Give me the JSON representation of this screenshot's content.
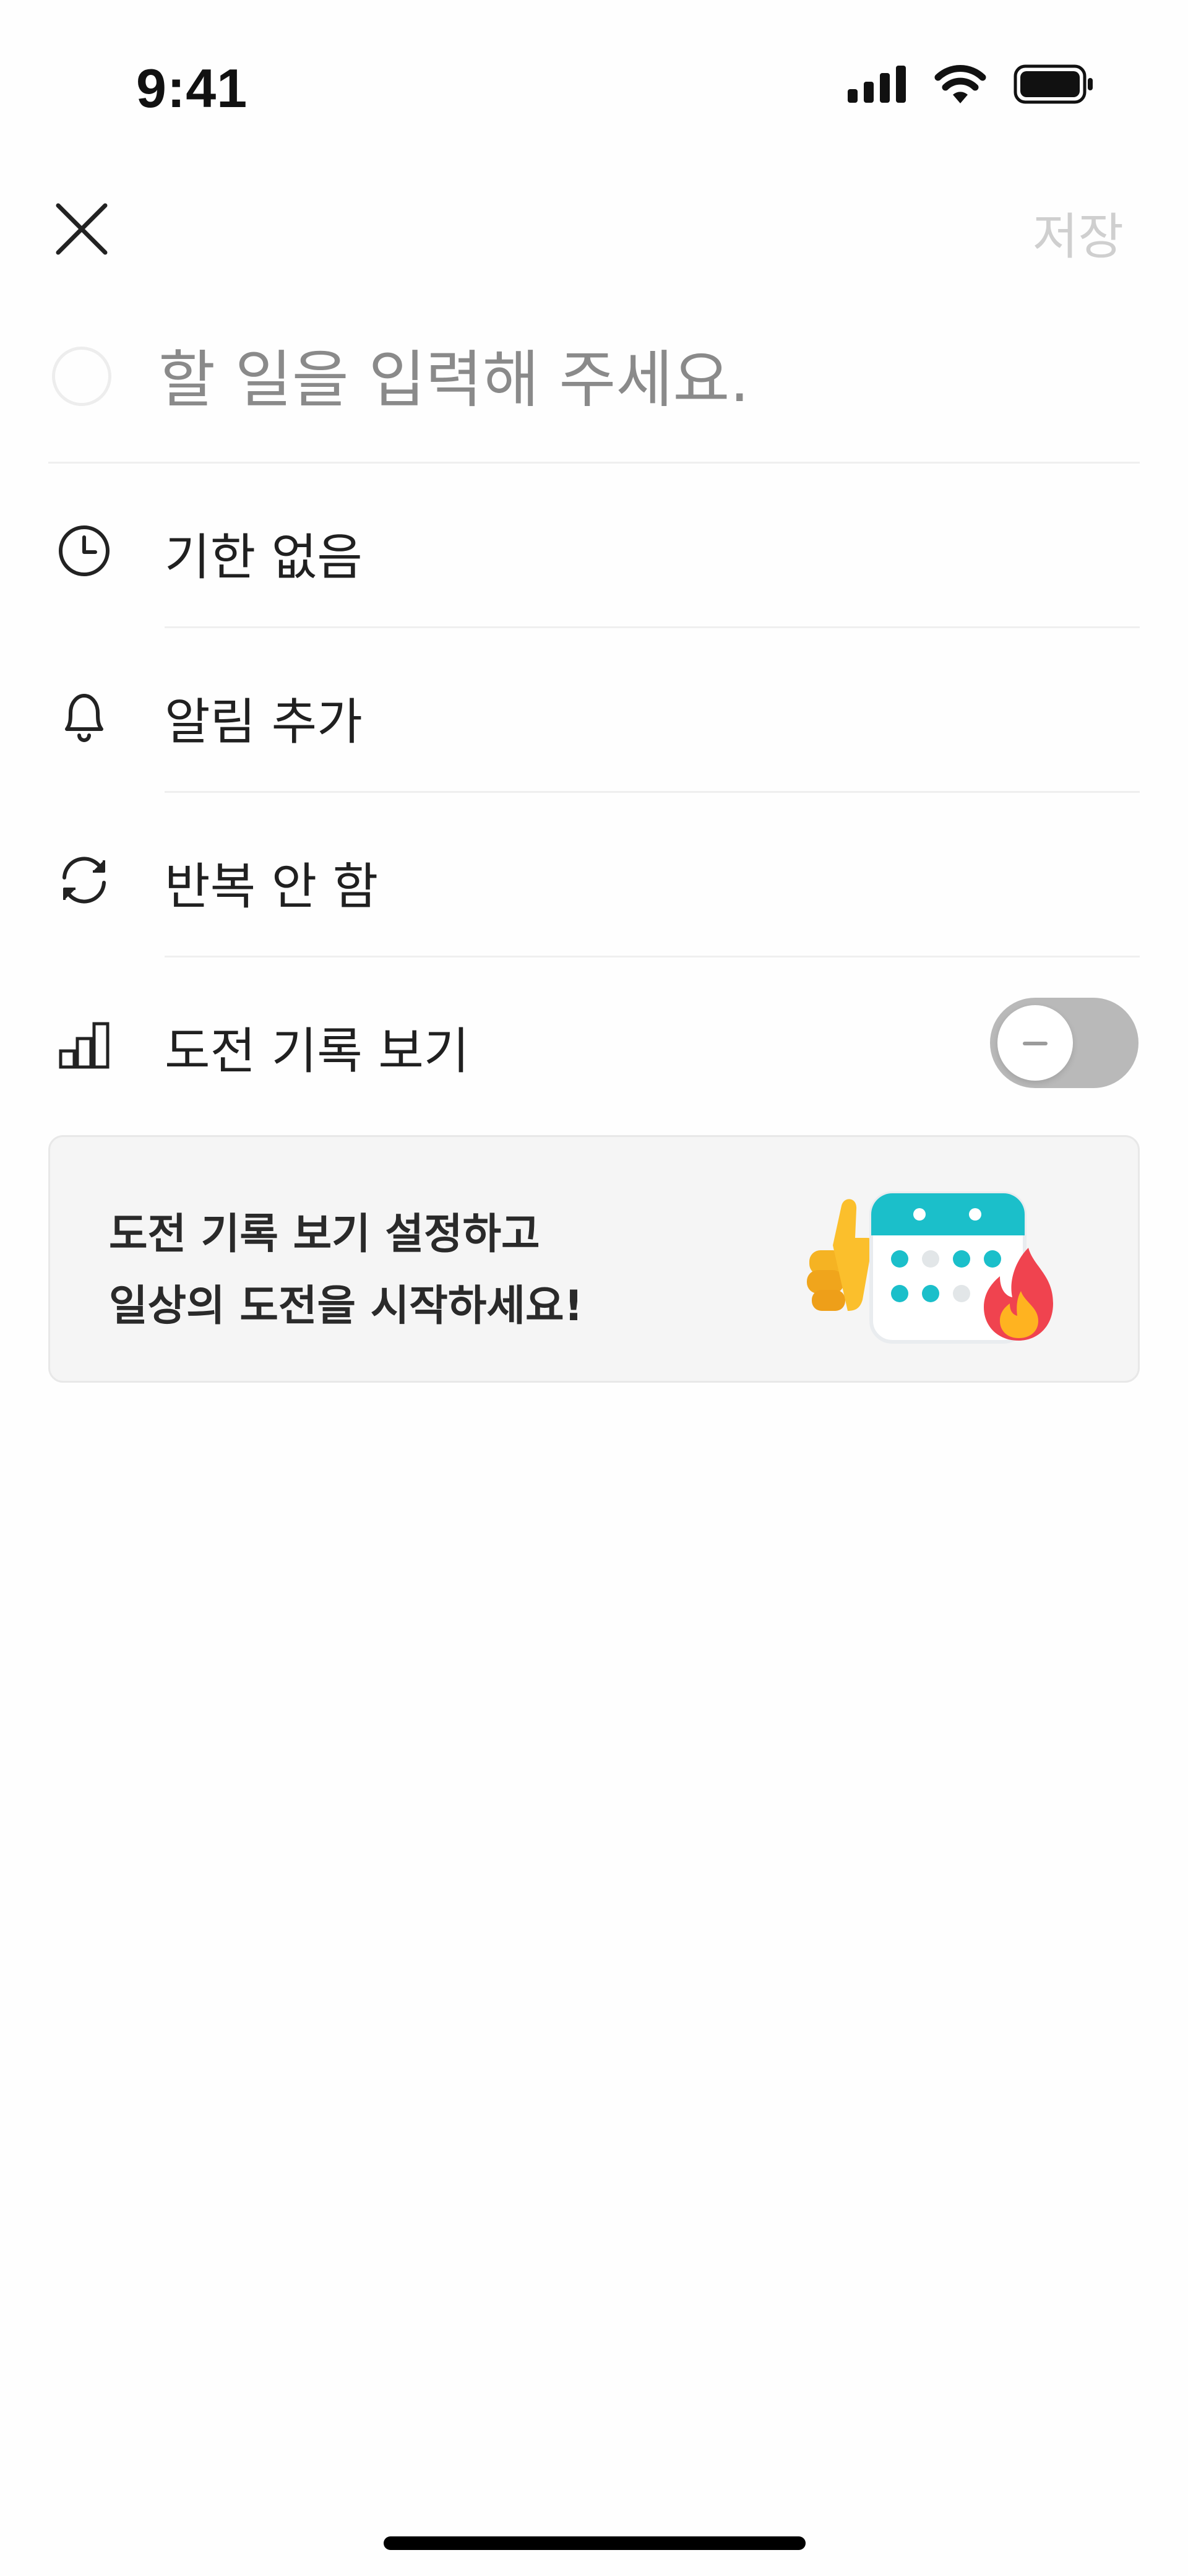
{
  "status_bar": {
    "time": "9:41",
    "icons": [
      "cellular-signal-icon",
      "wifi-icon",
      "battery-icon"
    ]
  },
  "header": {
    "close_icon": "close-icon",
    "save_label": "저장"
  },
  "task": {
    "placeholder": "할 일을 입력해 주세요.",
    "value": ""
  },
  "options": [
    {
      "icon": "clock-icon",
      "label": "기한 없음"
    },
    {
      "icon": "bell-icon",
      "label": "알림 추가"
    },
    {
      "icon": "repeat-icon",
      "label": "반복 안 함"
    },
    {
      "icon": "bar-chart-icon",
      "label": "도전 기록 보기"
    }
  ],
  "challenge_toggle": {
    "on": false
  },
  "promo": {
    "line1": "도전 기록 보기 설정하고",
    "line2": "일상의 도전을 시작하세요!",
    "illustration": "calendar-thumbs-up-fire-illustration"
  },
  "colors": {
    "accent_teal": "#1bbfca",
    "toggle_off": "#b9b9b9",
    "save_disabled": "#cfcfcf",
    "card_bg": "#f5f5f5"
  }
}
